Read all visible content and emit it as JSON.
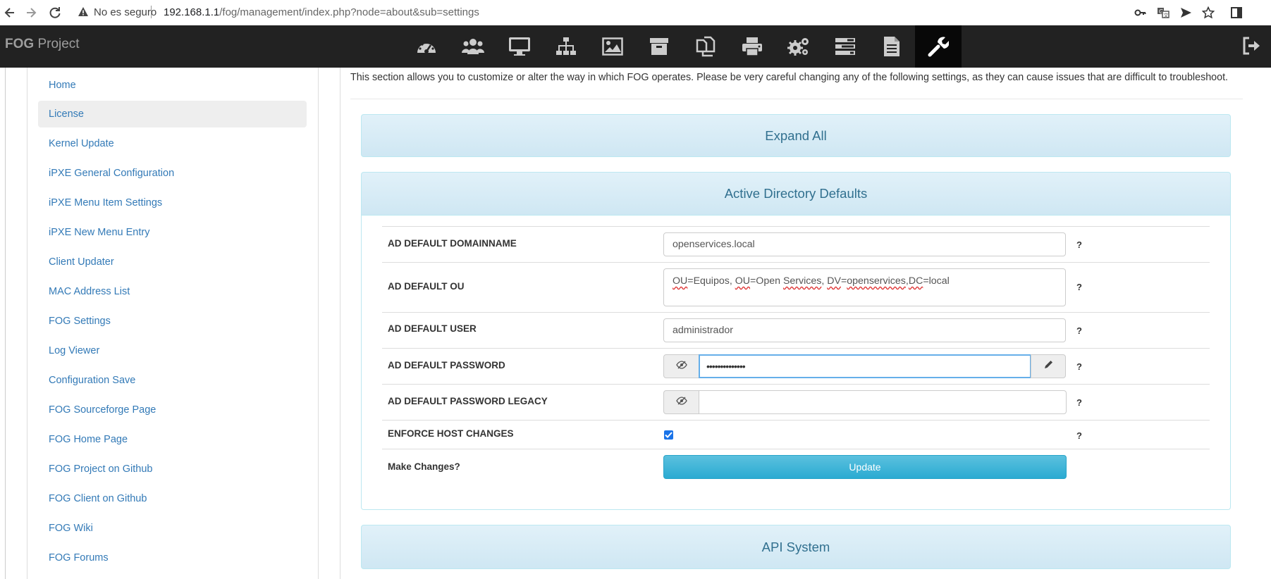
{
  "browser": {
    "security_label": "No es seguro",
    "url_host": "192.168.1.1",
    "url_path": "/fog/management/index.php?node=about&sub=settings",
    "icons": [
      "back-icon",
      "forward-icon",
      "reload-icon",
      "warning-icon",
      "key-icon",
      "translate-icon",
      "send-icon",
      "star-icon",
      "sidepanel-icon"
    ]
  },
  "header": {
    "brand_bold": "FOG",
    "brand_rest": " Project",
    "nav_icons": [
      "dashboard-icon",
      "users-icon",
      "hosts-icon",
      "groups-icon",
      "images-icon",
      "storage-icon",
      "snapins-icon",
      "printers-icon",
      "service-settings-icon",
      "tasks-icon",
      "reports-icon",
      "fog-configuration-icon"
    ],
    "active_nav": "fog-configuration-icon",
    "logout_icon": "logout-icon"
  },
  "sidebar": {
    "items": [
      {
        "label": "Home"
      },
      {
        "label": "License",
        "active": true
      },
      {
        "label": "Kernel Update"
      },
      {
        "label": "iPXE General Configuration"
      },
      {
        "label": "iPXE Menu Item Settings"
      },
      {
        "label": "iPXE New Menu Entry"
      },
      {
        "label": "Client Updater"
      },
      {
        "label": "MAC Address List"
      },
      {
        "label": "FOG Settings"
      },
      {
        "label": "Log Viewer"
      },
      {
        "label": "Configuration Save"
      },
      {
        "label": "FOG Sourceforge Page"
      },
      {
        "label": "FOG Home Page"
      },
      {
        "label": "FOG Project on Github"
      },
      {
        "label": "FOG Client on Github"
      },
      {
        "label": "FOG Wiki"
      },
      {
        "label": "FOG Forums"
      }
    ]
  },
  "main": {
    "intro": "This section allows you to customize or alter the way in which FOG operates. Please be very careful changing any of the following settings, as they can cause issues that are difficult to troubleshoot.",
    "expand_all": "Expand All",
    "panel_title": "Active Directory Defaults",
    "next_panel_title": "API System",
    "help_mark": "?",
    "rows": {
      "domainname": {
        "label": "AD DEFAULT DOMAINNAME",
        "value": "openservices.local"
      },
      "ou": {
        "label": "AD DEFAULT OU",
        "value": "OU=Equipos, OU=Open Services, DV=openservices,DC=local"
      },
      "user": {
        "label": "AD DEFAULT USER",
        "value": "administrador"
      },
      "password": {
        "label": "AD DEFAULT PASSWORD",
        "masked_value": "••••••••••••••"
      },
      "password_legacy": {
        "label": "AD DEFAULT PASSWORD LEGACY",
        "masked_value": ""
      },
      "enforce": {
        "label": "ENFORCE HOST CHANGES",
        "checked": true
      },
      "submit": {
        "label": "Make Changes?",
        "button": "Update"
      }
    }
  },
  "colors": {
    "topbar": "#222222",
    "link": "#337ab7",
    "panel_text": "#31708f",
    "panel_border": "#bce8f1",
    "button": "#31b0d5"
  }
}
